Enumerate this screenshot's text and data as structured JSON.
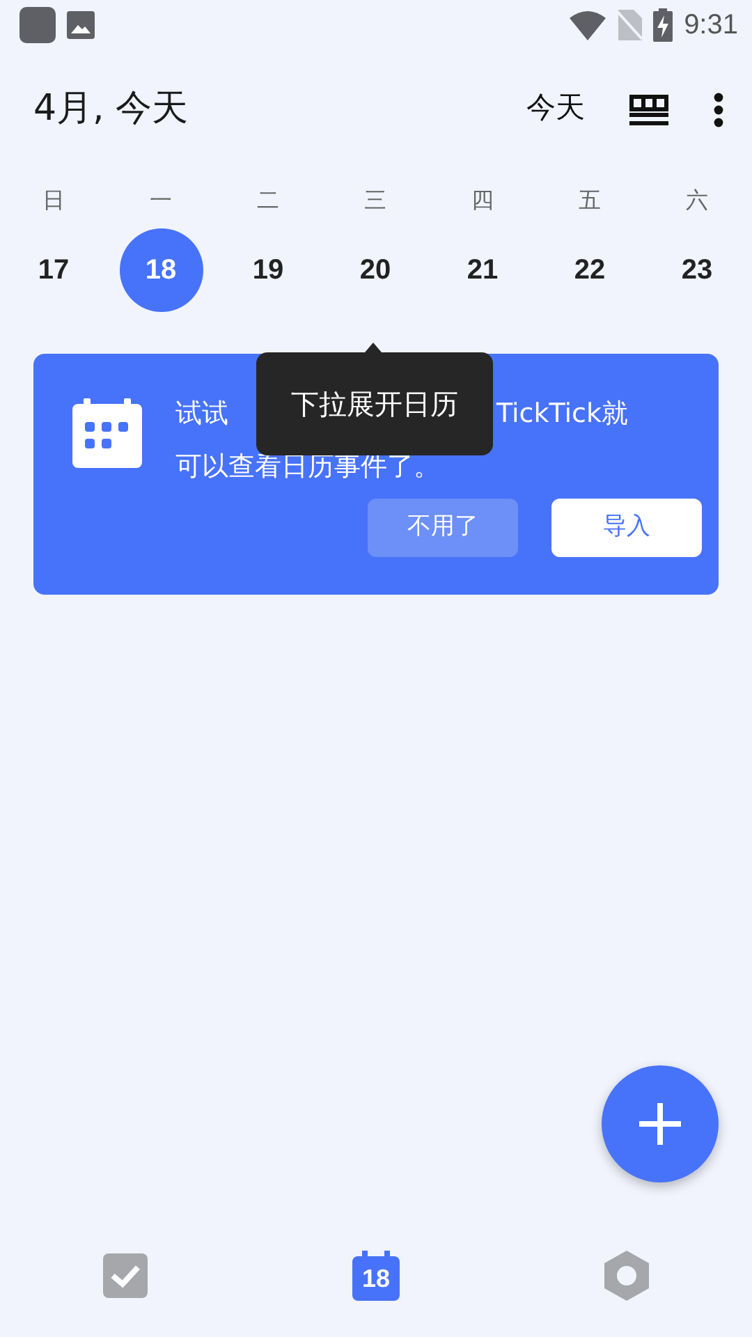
{
  "status_bar": {
    "time": "9:31"
  },
  "header": {
    "title": "4月, 今天",
    "today_button": "今天"
  },
  "week": [
    {
      "weekday": "日",
      "date": "17",
      "selected": false
    },
    {
      "weekday": "一",
      "date": "18",
      "selected": true
    },
    {
      "weekday": "二",
      "date": "19",
      "selected": false
    },
    {
      "weekday": "三",
      "date": "20",
      "selected": false
    },
    {
      "weekday": "四",
      "date": "21",
      "selected": false
    },
    {
      "weekday": "五",
      "date": "22",
      "selected": false
    },
    {
      "weekday": "六",
      "date": "23",
      "selected": false
    }
  ],
  "banner": {
    "line_1_start": "试试",
    "line_1_end": "TickTick就",
    "line_2": "可以查看日历事件了。",
    "buttons": [
      {
        "label": "不用了",
        "kind": "secondary"
      },
      {
        "label": "导入",
        "kind": "primary"
      }
    ]
  },
  "tooltip": {
    "text": "下拉展开日历"
  },
  "bottom_nav": [
    {
      "kind": "tasks",
      "selected": false
    },
    {
      "kind": "calendar",
      "label": "18",
      "selected": true
    },
    {
      "kind": "settings",
      "selected": false
    }
  ]
}
